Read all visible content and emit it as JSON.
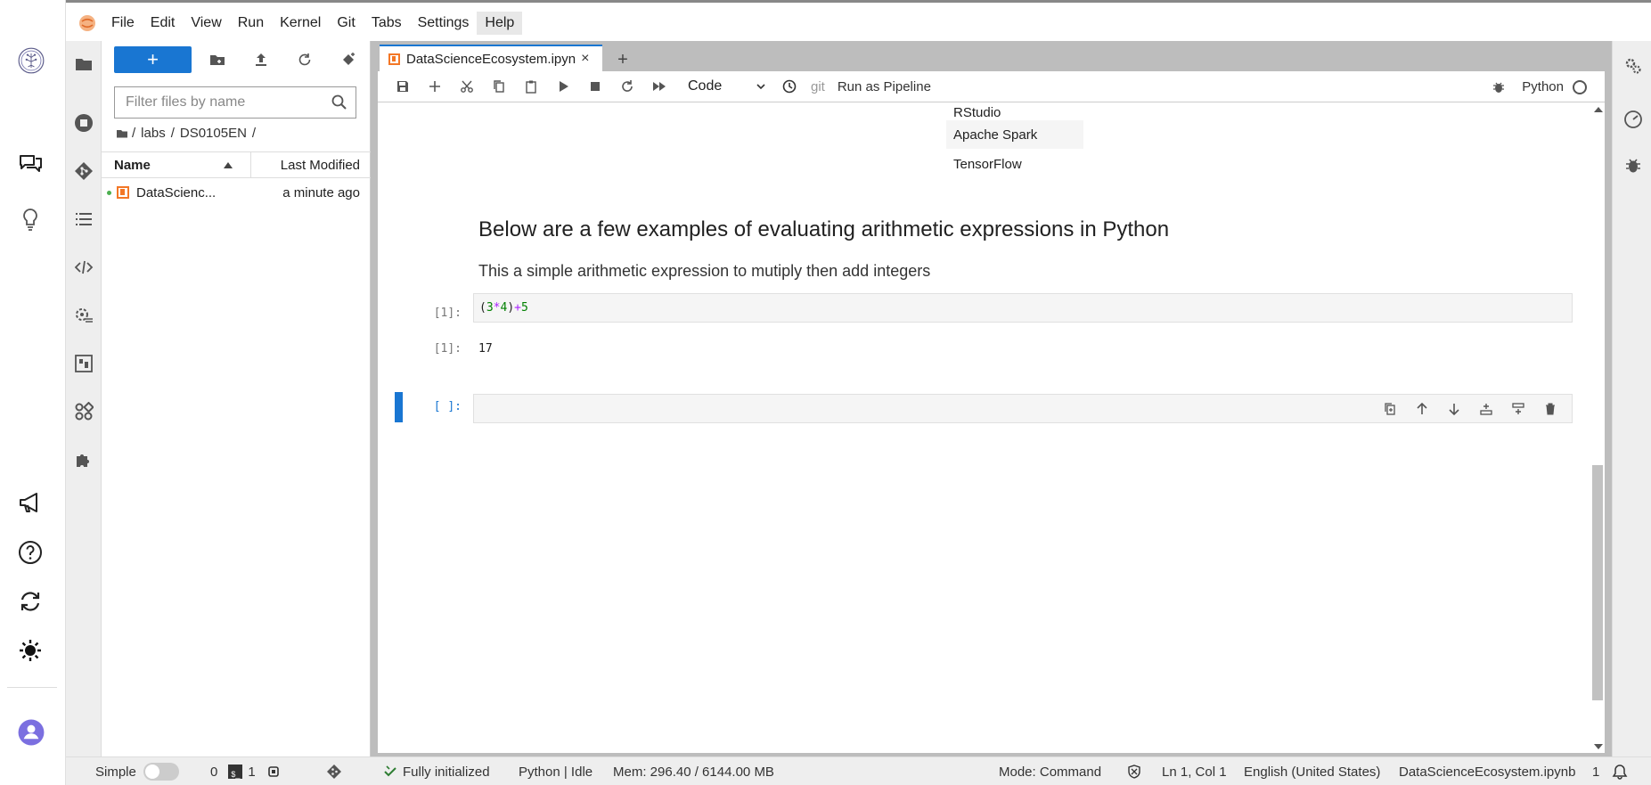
{
  "menubar": {
    "items": [
      "File",
      "Edit",
      "View",
      "Run",
      "Kernel",
      "Git",
      "Tabs",
      "Settings",
      "Help"
    ]
  },
  "file_browser": {
    "new_label": "+",
    "filter_placeholder": "Filter files by name",
    "breadcrumb": [
      "/",
      "labs",
      "/",
      "DS0105EN",
      "/"
    ],
    "columns": {
      "name": "Name",
      "modified": "Last Modified"
    },
    "files": [
      {
        "name": "DataScienc...",
        "modified": "a minute ago"
      }
    ]
  },
  "tabs": [
    {
      "label": "DataScienceEcosystem.ipyn",
      "close": "×"
    }
  ],
  "add_tab_label": "+",
  "notebook_toolbar": {
    "cell_type": "Code",
    "git_label": "git",
    "pipeline_label": "Run as Pipeline",
    "kernel_name": "Python"
  },
  "notebook": {
    "table_rows": [
      "RStudio",
      "Apache Spark",
      "TensorFlow"
    ],
    "heading": "Below are a few examples of evaluating arithmetic expressions in Python",
    "paragraph": "This a simple arithmetic expression to mutiply then add integers",
    "cells": [
      {
        "input_prompt": "[1]:",
        "code_tokens": [
          {
            "t": "(",
            "c": "paren"
          },
          {
            "t": "3",
            "c": "num"
          },
          {
            "t": "*",
            "c": "op"
          },
          {
            "t": "4",
            "c": "num"
          },
          {
            "t": ")",
            "c": "paren"
          },
          {
            "t": "+",
            "c": "op"
          },
          {
            "t": "5",
            "c": "num"
          }
        ],
        "output_prompt": "[1]:",
        "output": "17"
      },
      {
        "input_prompt": "[ ]:"
      }
    ]
  },
  "statusbar": {
    "mode_label": "Simple",
    "terminals_count": "0",
    "kernels_count": "1",
    "init_status": "Fully initialized",
    "kernel_status": "Python | Idle",
    "memory": "Mem: 296.40 / 6144.00 MB",
    "mode": "Mode: Command",
    "cursor": "Ln 1, Col 1",
    "language": "English (United States)",
    "filename": "DataScienceEcosystem.ipynb",
    "notifications": "1"
  },
  "colors": {
    "accent": "#1976d2",
    "notebook_orange": "#f37726",
    "dock_gray": "#bdbdbd"
  }
}
